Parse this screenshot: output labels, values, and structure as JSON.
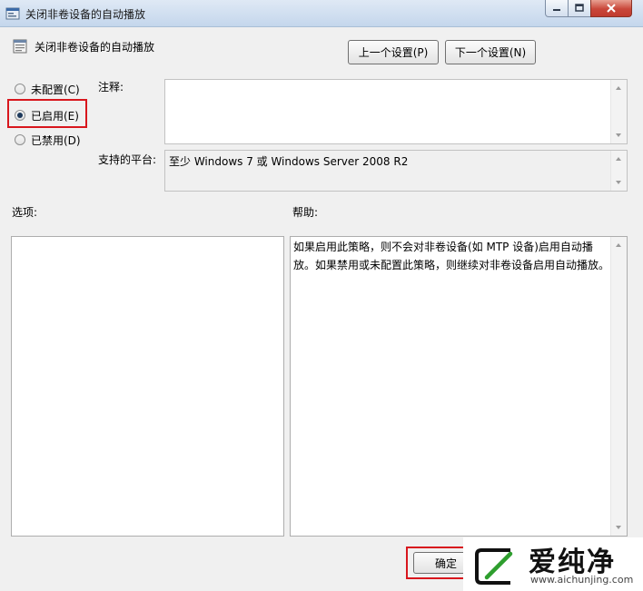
{
  "window": {
    "title": "关闭非卷设备的自动播放",
    "icon": "policy-icon"
  },
  "header": {
    "title": "关闭非卷设备的自动播放",
    "prev_label": "上一个设置(P)",
    "next_label": "下一个设置(N)"
  },
  "state": {
    "options": [
      {
        "label": "未配置(C)",
        "checked": false
      },
      {
        "label": "已启用(E)",
        "checked": true
      },
      {
        "label": "已禁用(D)",
        "checked": false
      }
    ]
  },
  "comment": {
    "label": "注释:",
    "value": ""
  },
  "platform": {
    "label": "支持的平台:",
    "value": "至少 Windows 7 或 Windows Server 2008 R2"
  },
  "options_panel": {
    "label": "选项:"
  },
  "help_panel": {
    "label": "帮助:",
    "text": "如果启用此策略，则不会对非卷设备(如 MTP 设备)启用自动播放。如果禁用或未配置此策略，则继续对非卷设备启用自动播放。"
  },
  "footer": {
    "ok_label": "确定"
  },
  "watermark": {
    "brand": "爱纯净",
    "url": "www.aichunjing.com"
  },
  "colors": {
    "highlight": "#d8161d",
    "client_bg": "#f0f0f0",
    "titlebar": "#c4d6ec"
  }
}
